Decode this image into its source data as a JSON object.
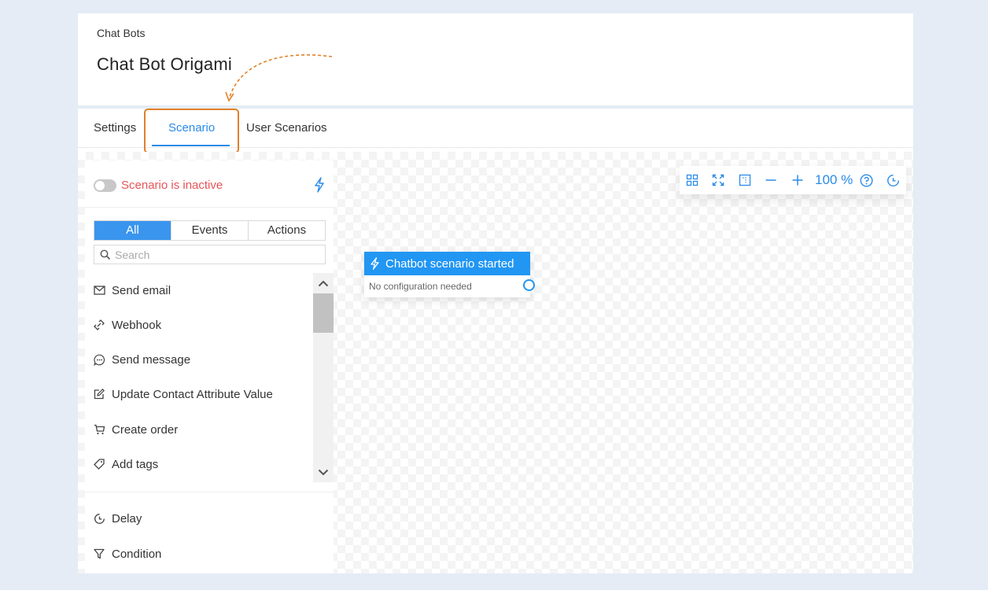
{
  "header": {
    "breadcrumb": "Chat Bots",
    "title": "Chat Bot Origami"
  },
  "tabs": [
    {
      "label": "Settings"
    },
    {
      "label": "Scenario",
      "active": true
    },
    {
      "label": "User Scenarios"
    }
  ],
  "panel": {
    "status": "Scenario is inactive",
    "filters": [
      "All",
      "Events",
      "Actions"
    ],
    "active_filter": "All",
    "search": {
      "placeholder": "Search",
      "value": ""
    },
    "items": [
      {
        "label": "Send email",
        "icon": "envelope-icon"
      },
      {
        "label": "Webhook",
        "icon": "webhook-icon"
      },
      {
        "label": "Send message",
        "icon": "chat-bubble-icon"
      },
      {
        "label": "Update Contact Attribute Value",
        "icon": "edit-icon"
      },
      {
        "label": "Create order",
        "icon": "cart-icon"
      },
      {
        "label": "Add tags",
        "icon": "tag-icon"
      }
    ],
    "logic_items": [
      {
        "label": "Delay",
        "icon": "clock-icon"
      },
      {
        "label": "Condition",
        "icon": "filter-icon"
      }
    ]
  },
  "toolbar": {
    "zoom": "100 %",
    "buttons": [
      "grid-icon",
      "fit-screen-icon",
      "select-area-icon",
      "zoom-out-icon",
      "zoom-in-icon",
      "help-icon",
      "history-icon"
    ]
  },
  "node": {
    "title": "Chatbot scenario started",
    "subtitle": "No configuration needed"
  },
  "colors": {
    "accent": "#2a8be8",
    "node_header": "#2196f3",
    "inactive": "#e8555a",
    "highlight": "#e0812b",
    "background": "#e5ecf6"
  }
}
